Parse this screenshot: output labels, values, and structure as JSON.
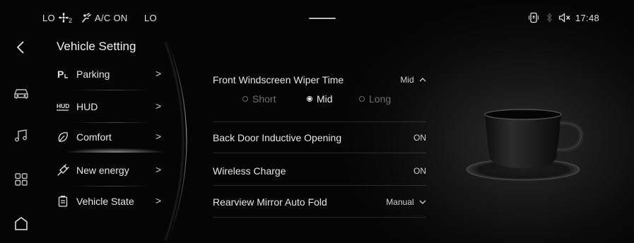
{
  "status_bar": {
    "left_temp": "LO",
    "fan_level": "2",
    "ac_label": "A/C ON",
    "right_temp": "LO",
    "time": "17:48",
    "icons": [
      "fan-icon",
      "seat-heat-icon",
      "phone-icon",
      "bluetooth-icon",
      "mute-icon"
    ]
  },
  "rail": {
    "items": [
      {
        "name": "back-icon"
      },
      {
        "name": "car-icon"
      },
      {
        "name": "music-icon"
      },
      {
        "name": "apps-icon"
      },
      {
        "name": "home-icon"
      }
    ]
  },
  "menu": {
    "title": "Vehicle Setting",
    "items": [
      {
        "label": "Parking",
        "icon": "parking-icon",
        "chevron": ">"
      },
      {
        "label": "HUD",
        "icon": "hud-icon",
        "chevron": ">"
      },
      {
        "label": "Comfort",
        "icon": "comfort-icon",
        "chevron": ">",
        "active": true
      },
      {
        "label": "New energy",
        "icon": "new-energy-icon",
        "chevron": ">"
      },
      {
        "label": "Vehicle State",
        "icon": "vehicle-state-icon",
        "chevron": ">"
      }
    ]
  },
  "settings": {
    "wiper": {
      "label": "Front Windscreen Wiper Time",
      "value": "Mid",
      "options": [
        "Short",
        "Mid",
        "Long"
      ],
      "selected": "Mid"
    },
    "back_door": {
      "label": "Back Door Inductive Opening",
      "value": "ON"
    },
    "wireless": {
      "label": "Wireless Charge",
      "value": "ON"
    },
    "mirror": {
      "label": "Rearview Mirror Auto Fold",
      "value": "Manual"
    }
  },
  "colors": {
    "background": "#050505",
    "text": "#e6e6e6",
    "muted": "#6f6f6f"
  }
}
